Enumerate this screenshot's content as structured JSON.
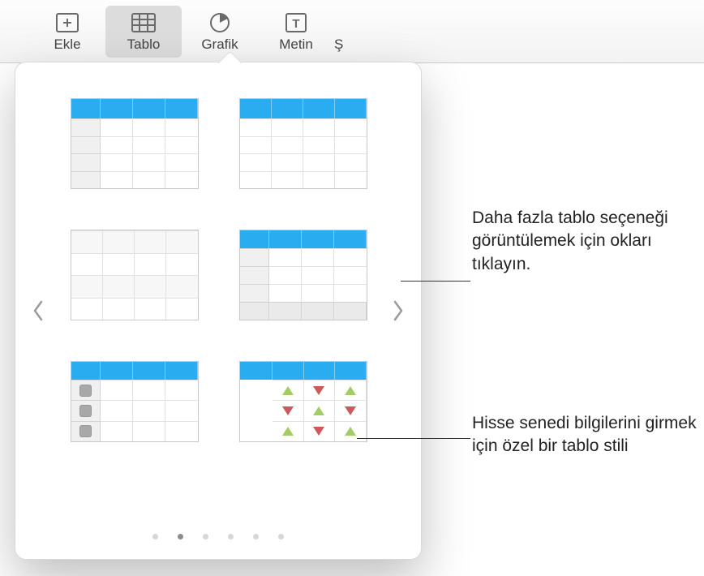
{
  "toolbar": {
    "insert": "Ekle",
    "table": "Tablo",
    "chart": "Grafik",
    "text": "Metin",
    "shape_partial": "Ş"
  },
  "popover": {
    "pages_total": 6,
    "active_page_index": 1,
    "left_arrow_name": "chevron-left-icon",
    "right_arrow_name": "chevron-right-icon",
    "thumbs": [
      "table-style-header-rowhead",
      "table-style-header-simple",
      "table-style-plain-grid",
      "table-style-header-footer",
      "table-style-checklist",
      "table-style-stock"
    ]
  },
  "callouts": {
    "arrows": "Daha fazla tablo seçeneği görüntülemek için okları tıklayın.",
    "stock": "Hisse senedi bilgilerini girmek için özel bir tablo stili"
  },
  "colors": {
    "accent": "#29adf0",
    "up_triangle": "#a2cc66",
    "down_triangle": "#cc5a5a"
  }
}
